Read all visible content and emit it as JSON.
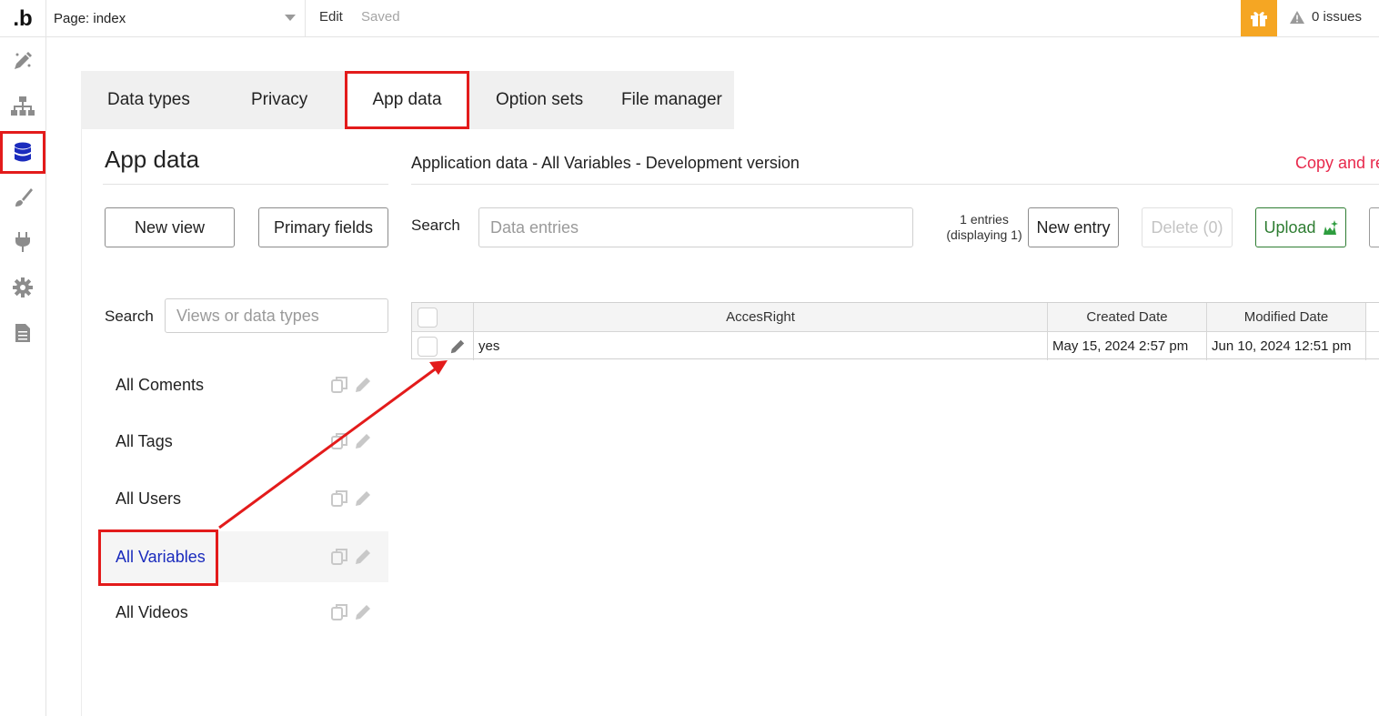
{
  "topbar": {
    "logo": ".b",
    "page_selector": "Page: index",
    "edit_label": "Edit",
    "saved_label": "Saved",
    "issues_label": "0 issues",
    "accent_color": "#f5a623"
  },
  "rail": {
    "icons": [
      "design-icon",
      "workflow-icon",
      "database-icon",
      "styles-icon",
      "plugins-icon",
      "settings-icon",
      "logs-icon"
    ],
    "active": "database-icon"
  },
  "tabs": [
    {
      "label": "Data types"
    },
    {
      "label": "Privacy"
    },
    {
      "label": "App data",
      "active": true
    },
    {
      "label": "Option sets"
    },
    {
      "label": "File manager"
    }
  ],
  "sidebar": {
    "title": "App data",
    "new_view_label": "New view",
    "primary_fields_label": "Primary fields",
    "search_label": "Search",
    "search_placeholder": "Views or data types",
    "items": [
      {
        "label": "All Coments"
      },
      {
        "label": "All Tags"
      },
      {
        "label": "All Users"
      },
      {
        "label": "All Variables",
        "active": true
      },
      {
        "label": "All Videos"
      }
    ]
  },
  "main": {
    "subtitle": "Application data - All Variables - Development version",
    "copy_link": "Copy and re",
    "search_label": "Search",
    "search_placeholder": "Data entries",
    "entries_info": "1 entries (displaying 1)",
    "new_entry_label": "New entry",
    "delete_label": "Delete (0)",
    "upload_label": "Upload",
    "table": {
      "columns": [
        "AccesRight",
        "Created Date",
        "Modified Date"
      ],
      "rows": [
        {
          "AccesRight": "yes",
          "Created Date": "May 15, 2024 2:57 pm",
          "Modified Date": "Jun 10, 2024 12:51 pm"
        }
      ]
    }
  },
  "annotation_color": "#e31b1b"
}
